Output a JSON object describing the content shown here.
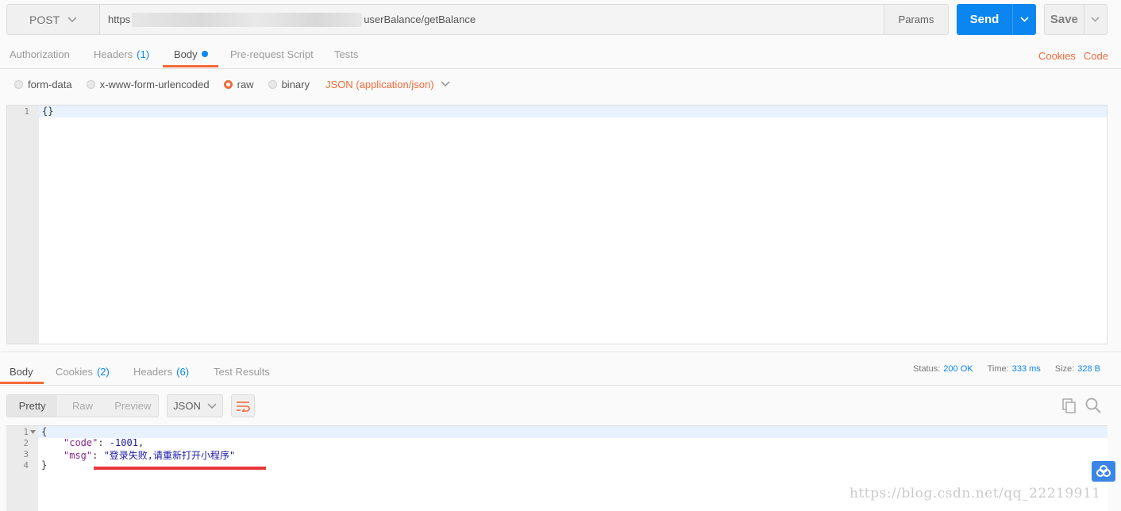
{
  "request": {
    "method": "POST",
    "url_prefix": "https",
    "url_suffix": "userBalance/getBalance",
    "params_label": "Params",
    "send_label": "Send",
    "save_label": "Save"
  },
  "request_tabs": {
    "authorization": "Authorization",
    "headers": "Headers",
    "headers_count": "(1)",
    "body": "Body",
    "prerequest": "Pre-request Script",
    "tests": "Tests"
  },
  "links": {
    "cookies": "Cookies",
    "code": "Code"
  },
  "body_types": {
    "form_data": "form-data",
    "urlencoded": "x-www-form-urlencoded",
    "raw": "raw",
    "binary": "binary",
    "content_type": "JSON (application/json)",
    "selected": "raw"
  },
  "request_body": {
    "line_numbers": [
      "1"
    ],
    "lines": [
      "{}"
    ]
  },
  "response_tabs": {
    "body": "Body",
    "cookies": "Cookies",
    "cookies_count": "(2)",
    "headers": "Headers",
    "headers_count": "(6)",
    "test_results": "Test Results"
  },
  "response_stats": {
    "status_label": "Status:",
    "status_value": "200 OK",
    "time_label": "Time:",
    "time_value": "333 ms",
    "size_label": "Size:",
    "size_value": "328 B"
  },
  "response_view": {
    "pretty": "Pretty",
    "raw": "Raw",
    "preview": "Preview",
    "format": "JSON"
  },
  "response_body": {
    "line_numbers": [
      "1",
      "2",
      "3",
      "4"
    ],
    "open_brace": "{",
    "code_key": "\"code\"",
    "code_value": "-1001",
    "msg_key": "\"msg\"",
    "msg_value": "\"登录失败,请重新打开小程序\"",
    "close_brace": "}"
  },
  "watermark": "https://blog.csdn.net/qq_22219911",
  "colors": {
    "accent": "#f26b3a",
    "primary": "#0b86f0",
    "underline_mark": "#e8373a"
  }
}
